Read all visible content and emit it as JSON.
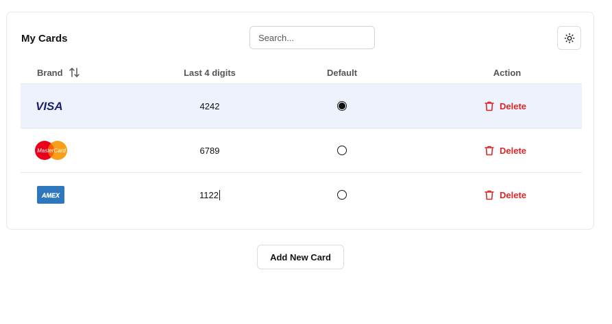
{
  "header": {
    "title": "My Cards",
    "search_placeholder": "Search..."
  },
  "table": {
    "columns": {
      "brand": "Brand",
      "last4": "Last 4 digits",
      "default": "Default",
      "action": "Action"
    },
    "rows": [
      {
        "brand": "VISA",
        "last4": "4242",
        "default": true,
        "action": "Delete"
      },
      {
        "brand": "MasterCard",
        "last4": "6789",
        "default": false,
        "action": "Delete"
      },
      {
        "brand": "AMEX",
        "last4": "1122",
        "default": false,
        "action": "Delete"
      }
    ]
  },
  "footer": {
    "add_button": "Add New Card"
  },
  "colors": {
    "selected_row": "#eef2fd",
    "delete": "#dc2626",
    "visa": "#1a1f71",
    "amex": "#2e77bc"
  },
  "icons": {
    "theme": "sun-icon",
    "sort": "sort-icon",
    "delete": "trash-icon"
  }
}
